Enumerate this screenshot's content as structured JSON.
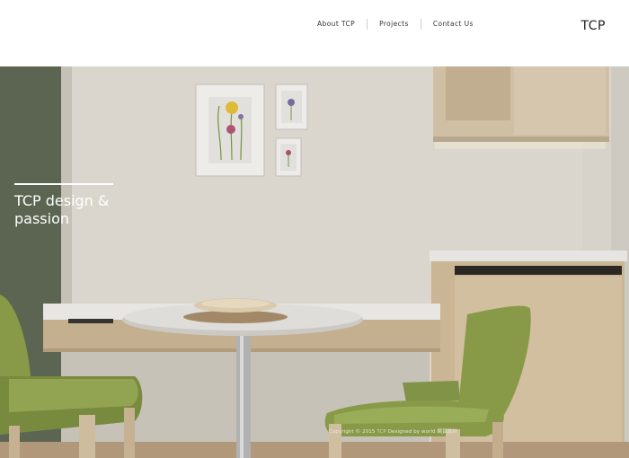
{
  "header": {
    "nav": [
      {
        "label": "About TCP"
      },
      {
        "label": "Projects"
      },
      {
        "label": "Contact Us"
      }
    ],
    "logo": "TCP"
  },
  "hero": {
    "tagline": "TCP design & passion"
  },
  "footer": {
    "copyright_prefix": "Copyright © 2015",
    "copyright_brand": "TCP",
    "copyright_suffix": "Designed by world 網頁設計"
  },
  "colors": {
    "header_bg": "#ffffff",
    "chair_green": "#8ea14a",
    "wall": "#e4e0d8",
    "wood": "#d6c2a5"
  }
}
